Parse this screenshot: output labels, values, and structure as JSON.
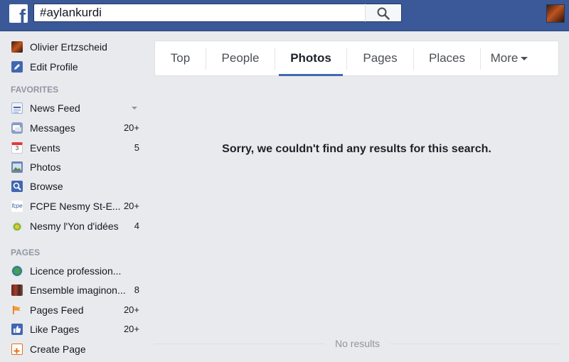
{
  "header": {
    "logo_letter": "f",
    "search": {
      "value": "#aylankurdi"
    }
  },
  "sidebar": {
    "profile": {
      "name": "Olivier Ertzscheid",
      "edit_label": "Edit Profile"
    },
    "favorites_header": "FAVORITES",
    "favorites": [
      {
        "label": "News Feed",
        "count": "",
        "icon": "news-feed-icon"
      },
      {
        "label": "Messages",
        "count": "20+",
        "icon": "messages-icon"
      },
      {
        "label": "Events",
        "count": "5",
        "icon": "events-icon"
      },
      {
        "label": "Photos",
        "count": "",
        "icon": "photos-icon"
      },
      {
        "label": "Browse",
        "count": "",
        "icon": "browse-icon"
      },
      {
        "label": "FCPE Nesmy St-E...",
        "count": "20+",
        "icon": "fcpe-group-icon"
      },
      {
        "label": "Nesmy l'Yon d'idées",
        "count": "4",
        "icon": "nesmy-group-icon"
      }
    ],
    "pages_header": "PAGES",
    "pages": [
      {
        "label": "Licence profession...",
        "count": "",
        "icon": "licence-page-icon"
      },
      {
        "label": "Ensemble imaginon...",
        "count": "8",
        "icon": "ensemble-page-icon"
      },
      {
        "label": "Pages Feed",
        "count": "20+",
        "icon": "pages-feed-icon"
      },
      {
        "label": "Like Pages",
        "count": "20+",
        "icon": "like-pages-icon"
      },
      {
        "label": "Create Page",
        "count": "",
        "icon": "create-page-icon"
      }
    ]
  },
  "tabs": [
    {
      "label": "Top",
      "active": false
    },
    {
      "label": "People",
      "active": false
    },
    {
      "label": "Photos",
      "active": true
    },
    {
      "label": "Pages",
      "active": false
    },
    {
      "label": "Places",
      "active": false
    },
    {
      "label": "More",
      "active": false
    }
  ],
  "main": {
    "empty_message": "Sorry, we couldn't find any results for this search.",
    "no_results": "No results"
  },
  "colors": {
    "brand_blue": "#3b5998",
    "active_tab_underline": "#4267b2",
    "background": "#e9eaed"
  }
}
